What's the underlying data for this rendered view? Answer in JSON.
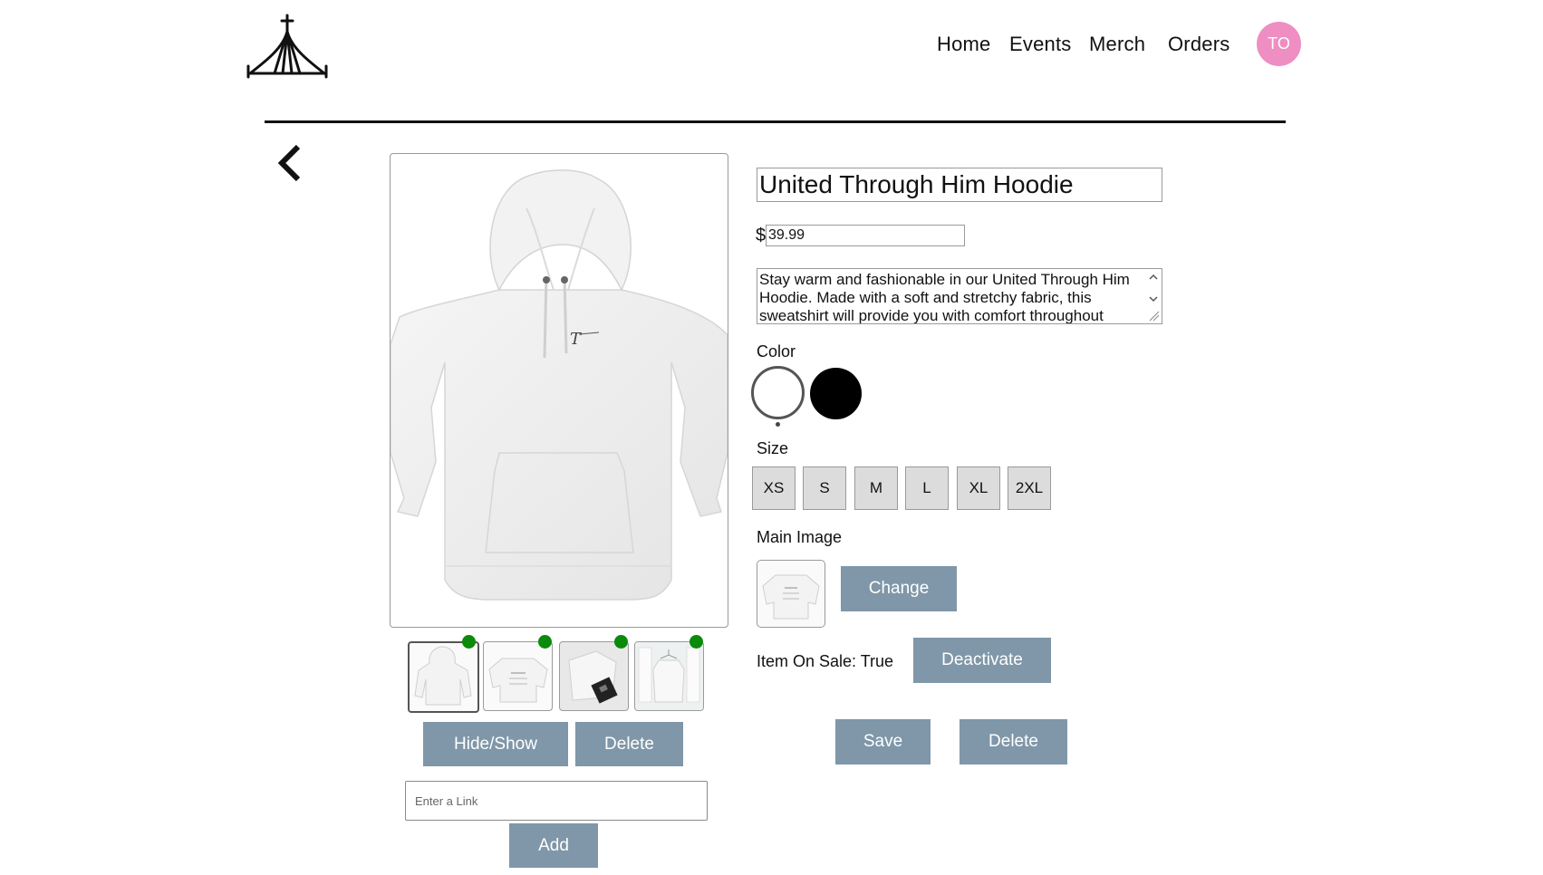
{
  "header": {
    "nav": [
      "Home",
      "Events",
      "Merch",
      "Orders"
    ],
    "avatar_initials": "TO",
    "avatar_color": "#ee8ec2"
  },
  "product": {
    "title": "United Through Him Hoodie",
    "currency_symbol": "$",
    "price": "39.99",
    "description": "Stay warm and fashionable in our United Through Him Hoodie. Made with a soft and stretchy fabric, this sweatshirt will provide you with comfort throughout",
    "color_label": "Color",
    "colors": [
      {
        "name": "white",
        "hex": "#ffffff",
        "selected": true
      },
      {
        "name": "black",
        "hex": "#000000",
        "selected": false
      }
    ],
    "size_label": "Size",
    "sizes": [
      "XS",
      "S",
      "M",
      "L",
      "XL",
      "2XL"
    ],
    "main_image_label": "Main Image",
    "change_label": "Change",
    "on_sale_text": "Item On Sale: True",
    "deactivate_label": "Deactivate",
    "save_label": "Save",
    "delete_label": "Delete"
  },
  "gallery": {
    "thumbnails": [
      "hoodie-front",
      "hoodie-flat",
      "hoodie-with-accessories",
      "hoodie-on-hanger"
    ],
    "status_color": "#0b8a0b",
    "hide_show_label": "Hide/Show",
    "delete_label": "Delete",
    "link_placeholder": "Enter a Link",
    "add_label": "Add"
  },
  "accent_button_color": "#7f97a8"
}
